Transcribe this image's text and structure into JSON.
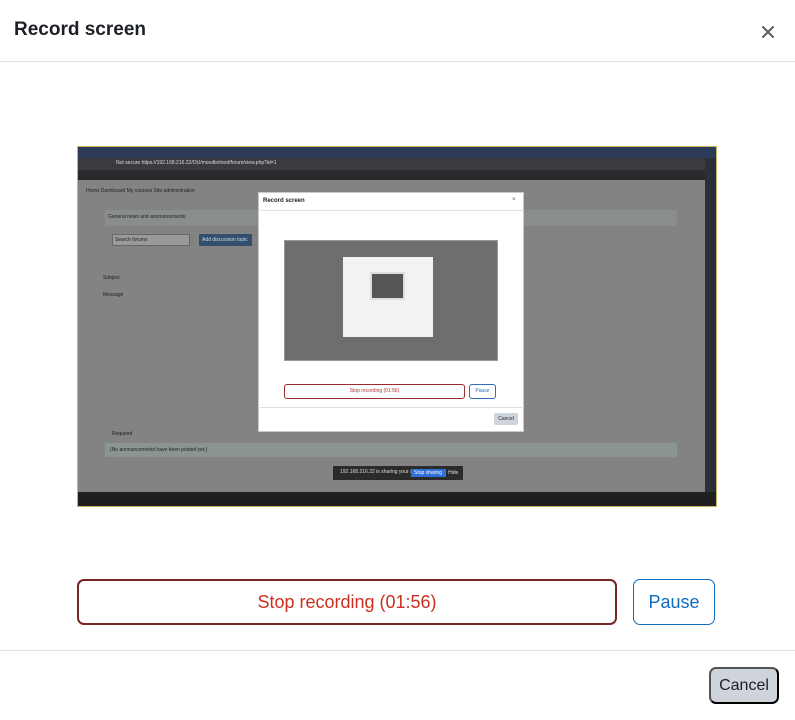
{
  "modal": {
    "title": "Record screen",
    "close_icon": "close-icon"
  },
  "preview": {
    "url": "Not secure   https://192.168.216.22/OU/moodle/mod/forum/view.php?id=1",
    "nav_text": "Home   Dashboard   My courses   Site administration",
    "forum_title": "General news and announcements",
    "search_placeholder": "Search forums",
    "add_button": "Add discussion topic",
    "subject_label": "Subject",
    "message_label": "Message",
    "required_label": "Required",
    "notice": "(No announcements have been posted yet.)",
    "share_text": "192.168.216.22 is sharing your screen.",
    "share_stop": "Stop sharing",
    "share_hide": "Hide",
    "inner_dialog": {
      "title": "Record screen",
      "stop_label": "Stop recording (01:56)",
      "pause_label": "Pause",
      "cancel_label": "Cancel"
    }
  },
  "actions": {
    "stop_label": "Stop recording (01:56)",
    "pause_label": "Pause"
  },
  "footer": {
    "cancel_label": "Cancel"
  },
  "colors": {
    "stop_text": "#ca3120",
    "stop_border": "#7a2525",
    "pause": "#0f6cbf",
    "cancel_bg": "#ced4da"
  }
}
